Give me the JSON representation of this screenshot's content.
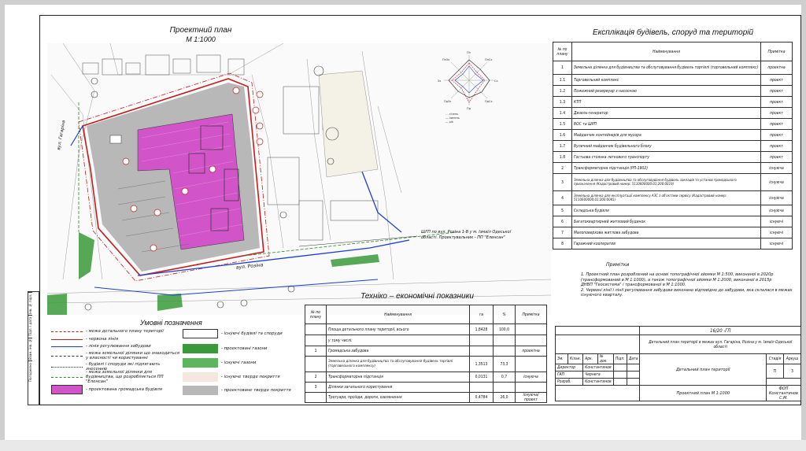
{
  "plan": {
    "title": "Проектний план",
    "scale": "М 1:1000",
    "street_left": "вул. Гагаріна",
    "street_bottom": "вул. Розіна",
    "callout": "ШГП по вул. Розіна 1-В у м. Ізмаїл Одеської області. Проектувальник - ПП \"Еленсан\"",
    "markers": [
      "1",
      "1",
      "2",
      "3",
      "4",
      "4",
      "5",
      "6",
      "7",
      "8",
      "9",
      "1.1",
      "1.2",
      "1.3",
      "1.4",
      "1.5",
      "1.6",
      "1.7",
      "1.8",
      "2",
      "4",
      "5",
      "7",
      "8"
    ]
  },
  "wind_rose": {
    "labels": [
      "Пн",
      "ПнСх",
      "Сх",
      "ПдСх",
      "Пд",
      "ПдЗх",
      "Зх",
      "ПнЗх"
    ],
    "legend": [
      "- - січень",
      "— липень",
      "— рік"
    ]
  },
  "explication": {
    "title": "Експлікація будівель, споруд та територій",
    "headers": [
      "№ по плану",
      "Найменування",
      "Примітка"
    ],
    "rows": [
      [
        "1",
        "Земельна ділянка для будівництва та обслуговування будівель торгівлі (торговельний комплекс)",
        "проектна"
      ],
      [
        "1.1",
        "Торговельний комплекс",
        "проект"
      ],
      [
        "1.2",
        "Пожежний резервуар з насосною",
        "проект"
      ],
      [
        "1.3",
        "КТП",
        "проект"
      ],
      [
        "1.4",
        "Дизель-генератор",
        "проект"
      ],
      [
        "1.5",
        "ВОС та ШРП",
        "проект"
      ],
      [
        "1.6",
        "Майданчик контейнерів для мусора",
        "проект"
      ],
      [
        "1.7",
        "Вуличний майданчик будівельного блоку",
        "проект"
      ],
      [
        "1.8",
        "Гостьова стоянка легкового транспорту",
        "проект"
      ],
      [
        "2",
        "Трансформаторна підстанція (РП-1902)",
        "існуюча"
      ],
      [
        "3",
        "Земельна ділянка для будівництва та обслуговування будівель закладів та установ громадського призначення (Кадастровий номер: 5110600000:01:200:0019)",
        "існуюча"
      ],
      [
        "4",
        "Земельна ділянка для експлуатації комплексу АЗС з об'єктами сервісу (Кадастровий номер: 5110600000:01:200:0041)",
        "існуюча"
      ],
      [
        "5",
        "Складська будівля",
        "існуюча"
      ],
      [
        "6",
        "Багатоквартирний житловий будинок",
        "існуючі"
      ],
      [
        "7",
        "Малоповерхова житлова забудова",
        "існуючі"
      ],
      [
        "8",
        "Гаражний кооператив",
        "існуючі"
      ]
    ]
  },
  "notes": {
    "title": "Примітки",
    "lines": [
      "1. Проектний план розроблений на основі топографічної зйомки М 1:500, виконаної в 2020р (трансформований в М 1:1000), а також топографічної зйомки М 1:2000, виконаної в 2015р",
      "ДНВП \"Геосистема\" і трансформованої в М 1:1000.",
      "2. Червоні лінії і лінії регулювання забудови виконано відповідно до забудови, яка склалася в межах",
      "існуючого кварталу."
    ]
  },
  "teo": {
    "title": "Техніко – економічні показники",
    "headers": [
      "№ по плану",
      "Найменування",
      "га",
      "%",
      "Примітка"
    ],
    "rows": [
      [
        "",
        "Площа детального плану території, всього",
        "1,8428",
        "100,0",
        ""
      ],
      [
        "",
        "у тому числі:",
        "",
        "",
        ""
      ],
      [
        "1",
        "Громадська забудова",
        "",
        "",
        "проектна"
      ],
      [
        "",
        "Земельна ділянка для будівництва та обслуговування будівель торгівлі (торговельного комплексу)",
        "1,3513",
        "73,3",
        ""
      ],
      [
        "2",
        "Трансформаторна підстанція",
        "0,0131",
        "0,7",
        "існуюча"
      ],
      [
        "3",
        "Ділянки загального користування",
        "",
        "",
        ""
      ],
      [
        "",
        "Тротуари, проїзди, дороги, озеленення",
        "0,4784",
        "26,0",
        "існуюча/проект"
      ]
    ]
  },
  "legend": {
    "title": "Умовні позначення",
    "left": [
      "- межа детального плану території",
      "- червона лінія",
      "- лінія регулювання забудови",
      "- межа земельної ділянки що знаходиться у власності чи користуванні",
      "- будівлі і споруди які підлягають знесенню",
      "- межа земельної ділянки для будівництва, що розробляється ПП \"Еленсан\"",
      "- проектована громадська будівля"
    ],
    "right": [
      "- існуючі будівлі та споруди",
      "- проектовані газони",
      "- існуючі газони",
      "- існуюче тверде покриття",
      "- проектоване тверде покриття"
    ]
  },
  "stamp": {
    "code": "16/20 -ГП",
    "project_title": "Детальний план території в межах вул. Гагаріна, Розіна у м. Ізмаїл Одеської області",
    "header_cells": [
      "Зм.",
      "Кільк.",
      "Арк.",
      "№ док.",
      "Підп.",
      "Дата"
    ],
    "roles": [
      [
        "Директор",
        "Константинов"
      ],
      [
        "ГАП",
        "Чернега"
      ],
      [
        "Розроб.",
        "Константинов"
      ]
    ],
    "doc_title": "Детальний план території",
    "stage_headers": [
      "Стадія",
      "Аркуш",
      "Аркушів"
    ],
    "stage_values": [
      "П",
      "3",
      ""
    ],
    "sheet_title": "Проектний план М 1:1000",
    "company": "ФОП Константинов С.М."
  },
  "margin": [
    "Інв. № підл.",
    "Підп. і дата",
    "Взам. інв. №",
    "Погоджено",
    ""
  ]
}
